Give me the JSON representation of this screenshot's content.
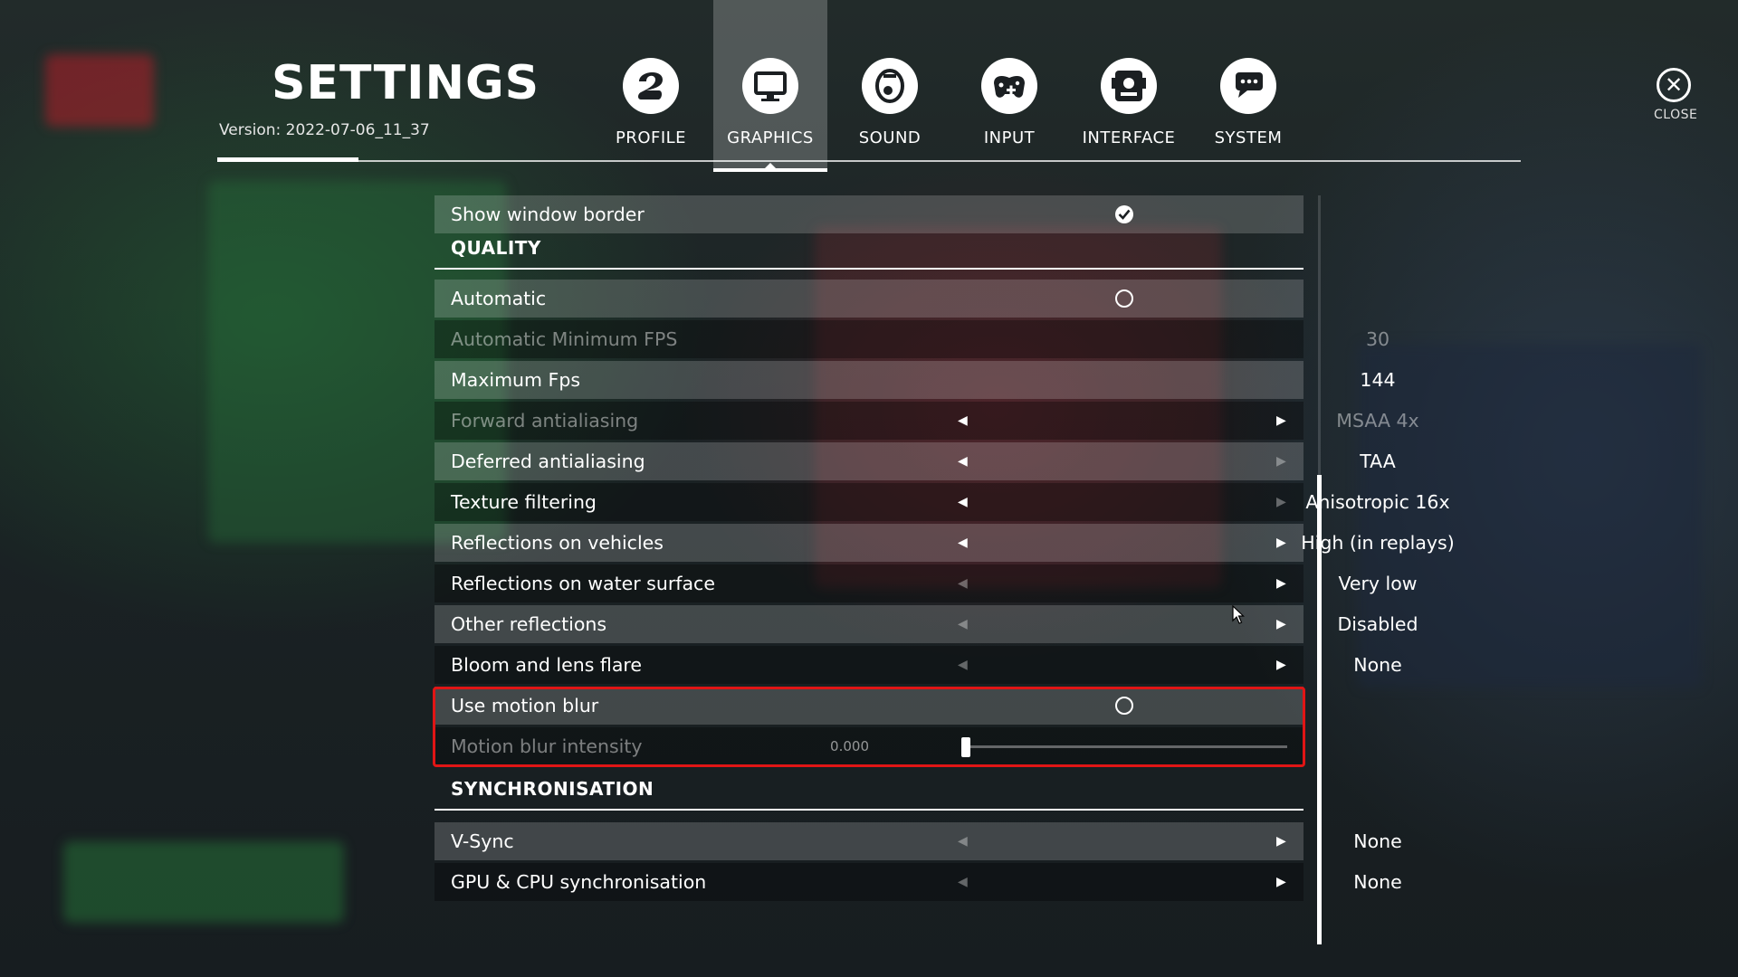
{
  "header": {
    "title": "SETTINGS",
    "version": "Version: 2022-07-06_11_37"
  },
  "tabs": [
    {
      "label": "PROFILE",
      "icon": "profile-icon",
      "active": false
    },
    {
      "label": "GRAPHICS",
      "icon": "monitor-icon",
      "active": true
    },
    {
      "label": "SOUND",
      "icon": "speaker-icon",
      "active": false
    },
    {
      "label": "INPUT",
      "icon": "gamepad-icon",
      "active": false
    },
    {
      "label": "INTERFACE",
      "icon": "interface-icon",
      "active": false
    },
    {
      "label": "SYSTEM",
      "icon": "chat-icon",
      "active": false
    }
  ],
  "close": {
    "label": "CLOSE",
    "icon": "close-icon"
  },
  "settings": {
    "show_window_border": {
      "label": "Show window border",
      "checked": true
    },
    "quality_header": "QUALITY",
    "automatic": {
      "label": "Automatic",
      "checked": false
    },
    "auto_min_fps": {
      "label": "Automatic Minimum FPS",
      "value": "30"
    },
    "max_fps": {
      "label": "Maximum Fps",
      "value": "144"
    },
    "forward_aa": {
      "label": "Forward antialiasing",
      "value": "MSAA 4x"
    },
    "deferred_aa": {
      "label": "Deferred antialiasing",
      "value": "TAA"
    },
    "texture_filtering": {
      "label": "Texture filtering",
      "value": "Anisotropic 16x"
    },
    "reflections_vehicles": {
      "label": "Reflections on vehicles",
      "value": "High (in replays)"
    },
    "reflections_water": {
      "label": "Reflections on water surface",
      "value": "Very low"
    },
    "other_reflections": {
      "label": "Other reflections",
      "value": "Disabled"
    },
    "bloom": {
      "label": "Bloom and lens flare",
      "value": "None"
    },
    "motion_blur": {
      "label": "Use motion blur",
      "checked": false
    },
    "motion_blur_intensity": {
      "label": "Motion blur intensity",
      "value": "0.000",
      "level": 0.0
    },
    "sync_header": "SYNCHRONISATION",
    "vsync": {
      "label": "V-Sync",
      "value": "None"
    },
    "gpu_cpu_sync": {
      "label": "GPU & CPU synchronisation",
      "value": "None"
    }
  },
  "colors": {
    "highlight_border": "#e01515",
    "row_light": "rgba(255,255,255,0.18)",
    "row_dark": "rgba(0,0,0,0.30)"
  }
}
